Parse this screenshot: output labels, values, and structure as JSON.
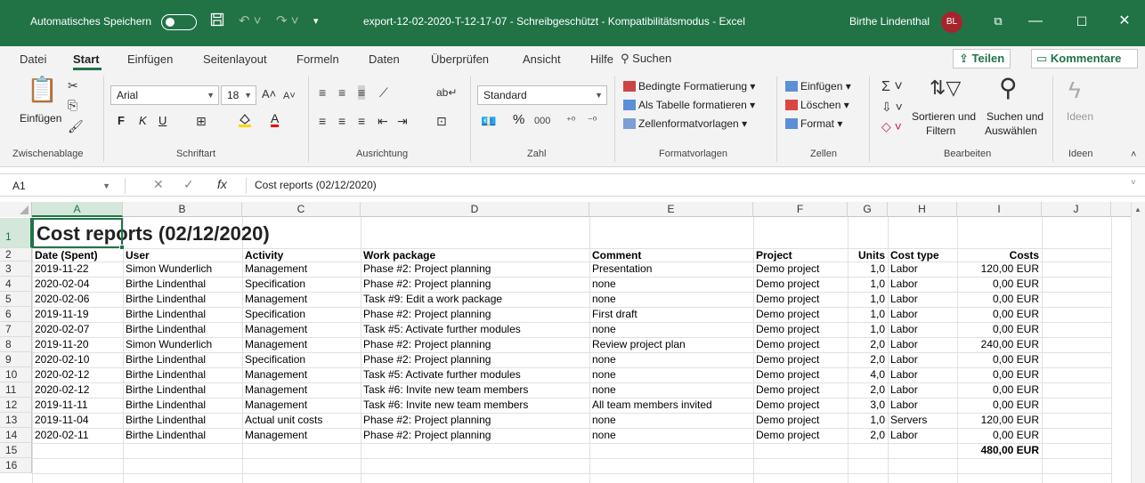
{
  "titlebar": {
    "autosave_label": "Automatisches Speichern",
    "title": "export-12-02-2020-T-12-17-07  -  Schreibgeschützt  -  Kompatibilitätsmodus  -  Excel",
    "user_name": "Birthe Lindenthal",
    "user_initials": "BL"
  },
  "tabs": [
    "Datei",
    "Start",
    "Einfügen",
    "Seitenlayout",
    "Formeln",
    "Daten",
    "Überprüfen",
    "Ansicht",
    "Hilfe"
  ],
  "search_label": "Suchen",
  "share_label": "Teilen",
  "comments_label": "Kommentare",
  "ribbon": {
    "clipboard": {
      "paste_label": "Einfügen",
      "group": "Zwischenablage"
    },
    "font": {
      "family": "Arial",
      "size": "18",
      "bold": "F",
      "italic": "K",
      "underline": "U",
      "color_a": "A",
      "group": "Schriftart"
    },
    "alignment": {
      "group": "Ausrichtung"
    },
    "number": {
      "format": "Standard",
      "percent": "%",
      "thousands": "000",
      "group": "Zahl"
    },
    "styles": {
      "cond_format": "Bedingte Formatierung",
      "as_table": "Als Tabelle formatieren",
      "cell_styles": "Zellenformatvorlagen",
      "group": "Formatvorlagen"
    },
    "cells": {
      "insert": "Einfügen",
      "delete": "Löschen",
      "format": "Format",
      "group": "Zellen"
    },
    "editing": {
      "sort_filter_1": "Sortieren und",
      "sort_filter_2": "Filtern",
      "find_select_1": "Suchen und",
      "find_select_2": "Auswählen",
      "group": "Bearbeiten"
    },
    "ideas": {
      "label": "Ideen",
      "group": "Ideen"
    }
  },
  "formula_bar": {
    "name_box": "A1",
    "fx": "fx",
    "content": "Cost reports (02/12/2020)"
  },
  "columns": [
    "A",
    "B",
    "C",
    "D",
    "E",
    "F",
    "G",
    "H",
    "I",
    "J"
  ],
  "row_numbers": [
    "1",
    "2",
    "3",
    "4",
    "5",
    "6",
    "7",
    "8",
    "9",
    "10",
    "11",
    "12",
    "13",
    "14",
    "15",
    "16"
  ],
  "sheet": {
    "title": "Cost reports (02/12/2020)",
    "headers": [
      "Date (Spent)",
      "User",
      "Activity",
      "Work package",
      "Comment",
      "Project",
      "Units",
      "Cost type",
      "Costs"
    ],
    "rows": [
      [
        "2019-11-22",
        "Simon Wunderlich",
        "Management",
        "Phase #2: Project planning",
        "Presentation",
        "Demo project",
        "1,0",
        "Labor",
        "120,00 EUR"
      ],
      [
        "2020-02-04",
        "Birthe Lindenthal",
        "Specification",
        "Phase #2: Project planning",
        "none",
        "Demo project",
        "1,0",
        "Labor",
        "0,00 EUR"
      ],
      [
        "2020-02-06",
        "Birthe Lindenthal",
        "Management",
        "Task #9: Edit a work package",
        "none",
        "Demo project",
        "1,0",
        "Labor",
        "0,00 EUR"
      ],
      [
        "2019-11-19",
        "Birthe Lindenthal",
        "Specification",
        "Phase #2: Project planning",
        "First draft",
        "Demo project",
        "1,0",
        "Labor",
        "0,00 EUR"
      ],
      [
        "2020-02-07",
        "Birthe Lindenthal",
        "Management",
        "Task #5: Activate further modules",
        "none",
        "Demo project",
        "1,0",
        "Labor",
        "0,00 EUR"
      ],
      [
        "2019-11-20",
        "Simon Wunderlich",
        "Management",
        "Phase #2: Project planning",
        "Review project plan",
        "Demo project",
        "2,0",
        "Labor",
        "240,00 EUR"
      ],
      [
        "2020-02-10",
        "Birthe Lindenthal",
        "Specification",
        "Phase #2: Project planning",
        "none",
        "Demo project",
        "2,0",
        "Labor",
        "0,00 EUR"
      ],
      [
        "2020-02-12",
        "Birthe Lindenthal",
        "Management",
        "Task #5: Activate further modules",
        "none",
        "Demo project",
        "4,0",
        "Labor",
        "0,00 EUR"
      ],
      [
        "2020-02-12",
        "Birthe Lindenthal",
        "Management",
        "Task #6: Invite new team members",
        "none",
        "Demo project",
        "2,0",
        "Labor",
        "0,00 EUR"
      ],
      [
        "2019-11-11",
        "Birthe Lindenthal",
        "Management",
        "Task #6: Invite new team members",
        "All team members invited",
        "Demo project",
        "3,0",
        "Labor",
        "0,00 EUR"
      ],
      [
        "2019-11-04",
        "Birthe Lindenthal",
        "Actual unit costs",
        "Phase #2: Project planning",
        "none",
        "Demo project",
        "1,0",
        "Servers",
        "120,00 EUR"
      ],
      [
        "2020-02-11",
        "Birthe Lindenthal",
        "Management",
        "Phase #2: Project planning",
        "none",
        "Demo project",
        "2,0",
        "Labor",
        "0,00 EUR"
      ]
    ],
    "total": "480,00 EUR"
  },
  "colors": {
    "accent": "#217346",
    "avatar": "#a4262c"
  }
}
